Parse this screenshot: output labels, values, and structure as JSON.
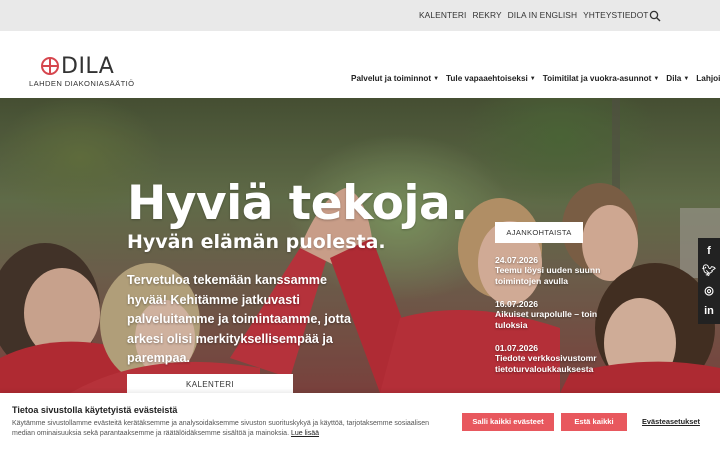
{
  "topbar": {
    "links": [
      "KALENTERI",
      "REKRY",
      "DILA IN ENGLISH",
      "YHTEYSTIEDOT"
    ],
    "search_icon": "search-icon"
  },
  "logo": {
    "word": "DILA",
    "subtitle": "LAHDEN DIAKONIASÄÄTIÖ",
    "mark_color": "#d6464e"
  },
  "nav": {
    "items": [
      "Palvelut ja toiminnot",
      "Tule vapaaehtoiseksi",
      "Toimitilat ja vuokra-asunnot",
      "Dila",
      "Lahjoita"
    ]
  },
  "hero": {
    "title": "Hyviä tekoja.",
    "subtitle": "Hyvän elämän puolesta.",
    "text": "Tervetuloa tekemään kanssamme hyvää! Kehitämme jatkuvasti palveluitamme ja toimintaamme, jotta arkesi olisi merkityksellisempää ja parempaa.",
    "button": "KALENTERI"
  },
  "news": {
    "heading": "AJANKOHTAISTA",
    "items": [
      {
        "date": "24.07.2026",
        "title": "Teemu löysi uuden suunn toimintojen avulla"
      },
      {
        "date": "16.07.2026",
        "title": "Aikuiset urapolulle – toin tuloksia"
      },
      {
        "date": "01.07.2026",
        "title": "Tiedote verkkosivustomr tietoturvaloukkauksesta"
      }
    ]
  },
  "social": {
    "icons": [
      "f",
      "t",
      "ig",
      "in"
    ]
  },
  "cookie": {
    "title": "Tietoa sivustolla käytetyistä evästeistä",
    "text": "Käytämme sivustollamme evästeitä kerätäksemme ja analysoidaksemme sivuston suorituskykyä ja käyttöä, tarjotaksemme sosiaalisen median ominaisuuksia sekä parantaaksemme ja räätälöidäksemme sisältöä ja mainoksia.",
    "more": "Lue lisää",
    "allow_all": "Salli kaikki evästeet",
    "deny_all": "Estä kaikki",
    "settings": "Evästeasetukset",
    "accent": "#e8585e"
  }
}
